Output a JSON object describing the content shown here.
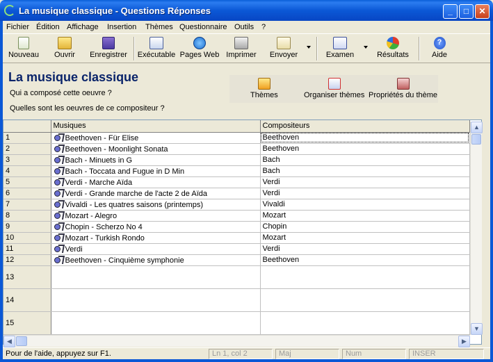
{
  "window": {
    "title": "La musique classique - Questions Réponses",
    "min_glyph": "_",
    "max_glyph": "□",
    "close_glyph": "✕"
  },
  "menu": [
    "Fichier",
    "Édition",
    "Affichage",
    "Insertion",
    "Thèmes",
    "Questionnaire",
    "Outils",
    "?"
  ],
  "toolbar": {
    "nouveau": "Nouveau",
    "ouvrir": "Ouvrir",
    "enregistrer": "Enregistrer",
    "executable": "Exécutable",
    "pages_web": "Pages Web",
    "imprimer": "Imprimer",
    "envoyer": "Envoyer",
    "examen": "Examen",
    "resultats": "Résultats",
    "aide": "Aide"
  },
  "header": {
    "title": "La musique classique",
    "question1": "Qui a composé cette oeuvre ?",
    "question2": "Quelles sont les oeuvres de ce compositeur ?",
    "themes": "Thèmes",
    "organiser": "Organiser thèmes",
    "proprietes": "Propriétés du thème"
  },
  "grid": {
    "col_musiques": "Musiques",
    "col_compositeurs": "Compositeurs",
    "rows": [
      {
        "n": "1",
        "musique": "Beethoven - Für Elise",
        "compositeur": "Beethoven"
      },
      {
        "n": "2",
        "musique": "Beethoven - Moonlight Sonata",
        "compositeur": "Beethoven"
      },
      {
        "n": "3",
        "musique": "Bach - Minuets in G",
        "compositeur": "Bach"
      },
      {
        "n": "4",
        "musique": "Bach - Toccata and Fugue in D Min",
        "compositeur": "Bach"
      },
      {
        "n": "5",
        "musique": "Verdi - Marche Aïda",
        "compositeur": "Verdi"
      },
      {
        "n": "6",
        "musique": "Verdi - Grande marche de l'acte 2 de Aïda",
        "compositeur": "Verdi"
      },
      {
        "n": "7",
        "musique": "Vivaldi - Les quatres saisons (printemps)",
        "compositeur": "Vivaldi"
      },
      {
        "n": "8",
        "musique": "Mozart - Alegro",
        "compositeur": "Mozart"
      },
      {
        "n": "9",
        "musique": "Chopin - Scherzo No 4",
        "compositeur": "Chopin"
      },
      {
        "n": "10",
        "musique": "Mozart - Turkish Rondo",
        "compositeur": "Mozart"
      },
      {
        "n": "11",
        "musique": "Verdi",
        "compositeur": "Verdi"
      },
      {
        "n": "12",
        "musique": "Beethoven - Cinquième symphonie",
        "compositeur": "Beethoven"
      }
    ],
    "empty_rows": [
      "13",
      "14",
      "15"
    ]
  },
  "statusbar": {
    "main": "Pour de l'aide, appuyez sur F1.",
    "position": "Ln 1, col 2",
    "maj": "Maj",
    "num": "Num",
    "inser": "INSER"
  }
}
